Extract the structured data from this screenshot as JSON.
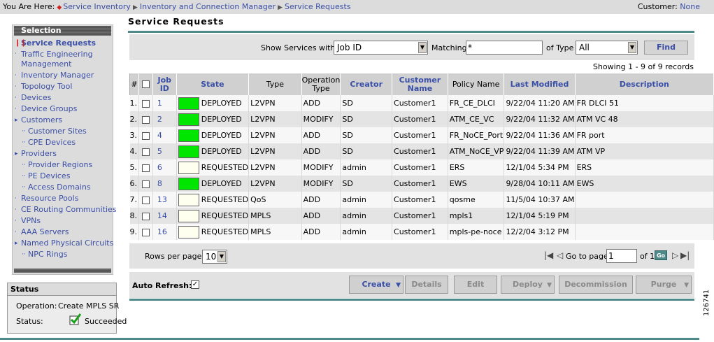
{
  "breadcrumb": {
    "prefix": "You Are Here:",
    "items": [
      "Service Inventory",
      "Inventory and Connection Manager",
      "Service Requests"
    ]
  },
  "customer": {
    "label": "Customer:",
    "value": "None"
  },
  "sidebar": {
    "title": "Selection",
    "items": [
      {
        "label": "Service Requests"
      },
      {
        "label": "Traffic Engineering Management"
      },
      {
        "label": "Inventory Manager"
      },
      {
        "label": "Topology Tool"
      },
      {
        "label": ""
      },
      {
        "label": "Devices"
      },
      {
        "label": "Device Groups"
      },
      {
        "label": "Customers"
      },
      {
        "label": "Customer Sites"
      },
      {
        "label": "CPE Devices"
      },
      {
        "label": "Providers"
      },
      {
        "label": "Provider Regions"
      },
      {
        "label": "PE Devices"
      },
      {
        "label": "Access Domains"
      },
      {
        "label": "Resource Pools"
      },
      {
        "label": "CE Routing Communities"
      },
      {
        "label": "VPNs"
      },
      {
        "label": "AAA Servers"
      },
      {
        "label": "Named Physical Circuits"
      },
      {
        "label": "NPC Rings"
      }
    ]
  },
  "status": {
    "title": "Status",
    "operation_label": "Operation:",
    "operation_value": "Create MPLS SR",
    "status_label": "Status:",
    "status_value": "Succeeded"
  },
  "page_title": "Service Requests",
  "filter": {
    "show_label": "Show Services with",
    "field_value": "Job ID",
    "matching_label": "Matching",
    "matching_value": "*",
    "type_label": "of Type",
    "type_value": "All",
    "find_label": "Find"
  },
  "showing": "Showing 1 - 9 of 9 records",
  "table": {
    "columns": [
      "#",
      "",
      "Job ID",
      "State",
      "Type",
      "Operation Type",
      "Creator",
      "Customer Name",
      "Policy Name",
      "Last Modified",
      "Description"
    ],
    "rows": [
      {
        "n": "1.",
        "job": "1",
        "color": "#00e600",
        "state": "DEPLOYED",
        "type": "L2VPN",
        "op": "ADD",
        "creator": "SD",
        "customer": "Customer1",
        "policy": "FR_CE_DLCI",
        "modified": "9/22/04 11:20 AM",
        "desc": "FR DLCI 51"
      },
      {
        "n": "2.",
        "job": "2",
        "color": "#00e600",
        "state": "DEPLOYED",
        "type": "L2VPN",
        "op": "MODIFY",
        "creator": "SD",
        "customer": "Customer1",
        "policy": "ATM_CE_VC",
        "modified": "9/22/04 11:32 AM",
        "desc": "ATM VC 48"
      },
      {
        "n": "3.",
        "job": "4",
        "color": "#00e600",
        "state": "DEPLOYED",
        "type": "L2VPN",
        "op": "ADD",
        "creator": "SD",
        "customer": "Customer1",
        "policy": "FR_NoCE_Port",
        "modified": "9/22/04 11:36 AM",
        "desc": "FR port"
      },
      {
        "n": "4.",
        "job": "5",
        "color": "#00e600",
        "state": "DEPLOYED",
        "type": "L2VPN",
        "op": "ADD",
        "creator": "SD",
        "customer": "Customer1",
        "policy": "ATM_NoCE_VP",
        "modified": "9/22/04 11:39 AM",
        "desc": "ATM VP"
      },
      {
        "n": "5.",
        "job": "6",
        "color": "#fffff0",
        "state": "REQUESTED",
        "type": "L2VPN",
        "op": "MODIFY",
        "creator": "admin",
        "customer": "Customer1",
        "policy": "ERS",
        "modified": "12/1/04 5:34 PM",
        "desc": "ERS"
      },
      {
        "n": "6.",
        "job": "8",
        "color": "#00e600",
        "state": "DEPLOYED",
        "type": "L2VPN",
        "op": "MODIFY",
        "creator": "SD",
        "customer": "Customer1",
        "policy": "EWS",
        "modified": "9/28/04 10:11 AM",
        "desc": "EWS"
      },
      {
        "n": "7.",
        "job": "13",
        "color": "#fffff0",
        "state": "REQUESTED",
        "type": "QoS",
        "op": "ADD",
        "creator": "admin",
        "customer": "Customer1",
        "policy": "qosme",
        "modified": "11/5/04 10:37 AM",
        "desc": ""
      },
      {
        "n": "8.",
        "job": "14",
        "color": "#fffff0",
        "state": "REQUESTED",
        "type": "MPLS",
        "op": "ADD",
        "creator": "admin",
        "customer": "Customer1",
        "policy": "mpls1",
        "modified": "12/1/04 5:19 PM",
        "desc": ""
      },
      {
        "n": "9.",
        "job": "16",
        "color": "#fffff0",
        "state": "REQUESTED",
        "type": "MPLS",
        "op": "ADD",
        "creator": "admin",
        "customer": "Customer1",
        "policy": "mpls-pe-noce",
        "modified": "12/2/04 3:12 PM",
        "desc": ""
      }
    ]
  },
  "pager": {
    "rows_label": "Rows per page:",
    "rows_value": "10",
    "goto_label": "Go to page:",
    "page_value": "1",
    "of_label": "of 1",
    "go_label": "Go"
  },
  "actions": {
    "auto_refresh_label": "Auto Refresh:",
    "auto_refresh_mark": "✓",
    "create": "Create",
    "details": "Details",
    "edit": "Edit",
    "deploy": "Deploy",
    "decommission": "Decommission",
    "purge": "Purge"
  },
  "figure_id": "126741",
  "colors": {
    "accent": "#4f8a8a",
    "link": "#3a4fa6",
    "deployed": "#00e600",
    "requested": "#fffff0"
  }
}
